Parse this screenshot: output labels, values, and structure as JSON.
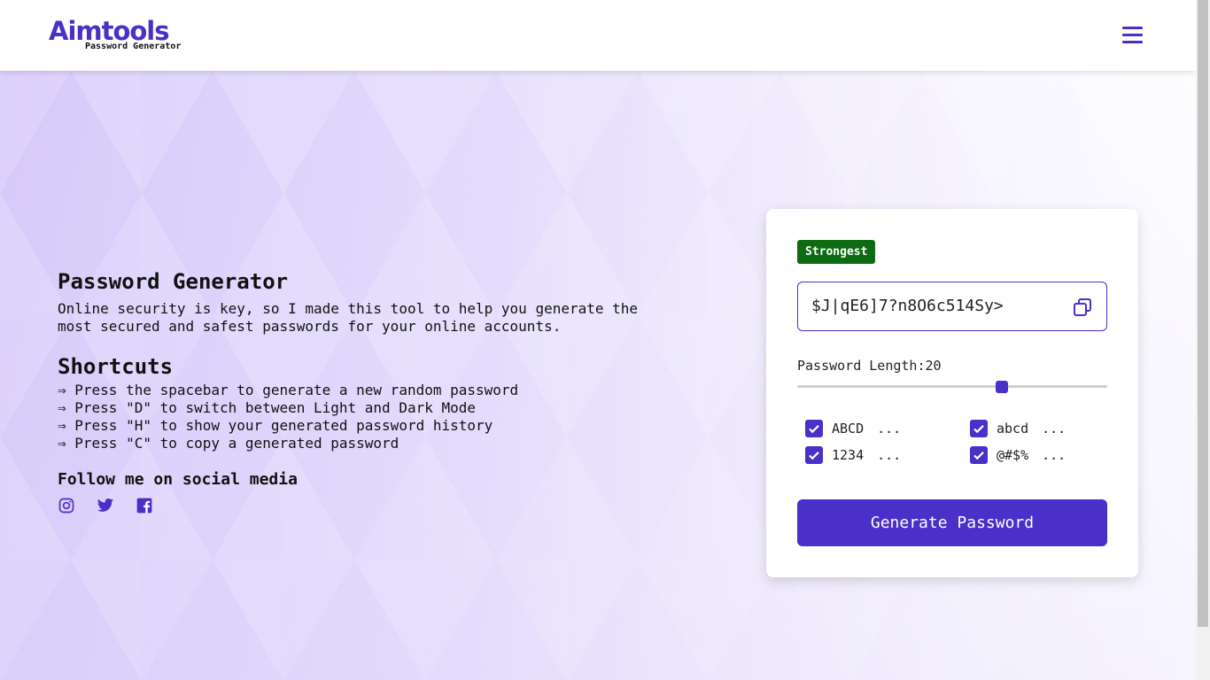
{
  "header": {
    "logo_text": "Aimtools",
    "logo_subtitle": "Password Generator",
    "menu_icon": "hamburger-menu-icon"
  },
  "intro": {
    "title": "Password Generator",
    "description": "Online security is key, so I made this tool to help you generate the most secured and safest passwords for your online accounts."
  },
  "shortcuts": {
    "title": "Shortcuts",
    "items": [
      "⇒ Press the spacebar to generate a new random password",
      "⇒ Press \"D\" to switch between Light and Dark Mode",
      "⇒ Press \"H\" to show your generated password history",
      "⇒ Press \"C\" to copy a generated password"
    ]
  },
  "social": {
    "title": "Follow me on social media",
    "icons": [
      "instagram-icon",
      "twitter-icon",
      "facebook-icon"
    ]
  },
  "generator": {
    "strength_badge": "Strongest",
    "password": "$J|qE6]7?n8O6c514Sy>",
    "length_label": "Password Length:",
    "length_value": "20",
    "length_fraction": 0.66,
    "options": [
      {
        "label": "ABCD",
        "checked": true,
        "more": "..."
      },
      {
        "label": "abcd",
        "checked": true,
        "more": "..."
      },
      {
        "label": "1234",
        "checked": true,
        "more": "..."
      },
      {
        "label": "@#$%",
        "checked": true,
        "more": "..."
      }
    ],
    "generate_label": "Generate Password"
  },
  "colors": {
    "accent": "#4a2fc9",
    "badge": "#0d6b12"
  }
}
